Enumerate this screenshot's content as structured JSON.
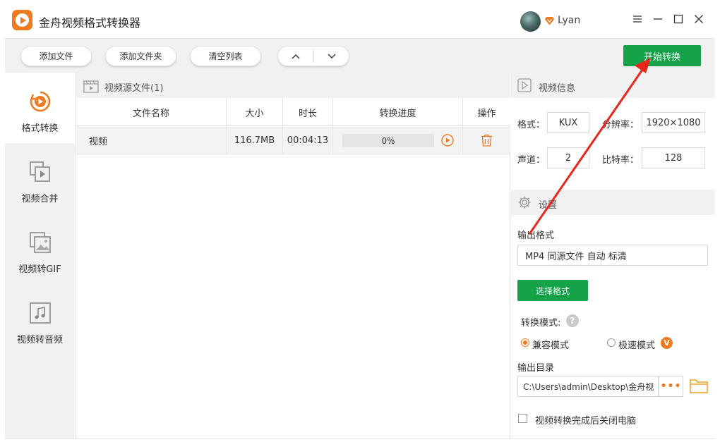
{
  "app": {
    "title": "金舟视频格式转换器",
    "username": "Lyan"
  },
  "toolbar": {
    "add_file": "添加文件",
    "add_folder": "添加文件夹",
    "clear_list": "清空列表",
    "start_convert": "开始转换"
  },
  "nav": {
    "items": [
      {
        "label": "格式转换",
        "icon": "format-convert-icon",
        "active": true
      },
      {
        "label": "视频合并",
        "icon": "video-merge-icon",
        "active": false
      },
      {
        "label": "视频转GIF",
        "icon": "gif-image-icon",
        "active": false
      },
      {
        "label": "视频转音频",
        "icon": "music-note-icon",
        "active": false
      }
    ]
  },
  "filelist": {
    "header": "视频源文件(1)",
    "columns": [
      "文件名称",
      "大小",
      "时长",
      "转换进度",
      "操作"
    ],
    "rows": [
      {
        "name": "视频",
        "size": "116.7MB",
        "duration": "00:04:13",
        "progress_text": "0%",
        "progress": 0
      }
    ]
  },
  "video_info": {
    "header": "视频信息",
    "format_label": "格式：",
    "format_value": "KUX",
    "resolution_label": "分辨率：",
    "resolution_value": "1920×1080",
    "channels_label": "声道：",
    "channels_value": "2",
    "bitrate_label": "比特率：",
    "bitrate_value": "128"
  },
  "settings": {
    "header": "设置",
    "output_format_label": "输出格式",
    "output_format_value": "MP4 同源文件 自动 标清",
    "select_format_button": "选择格式",
    "mode_label": "转换模式:",
    "mode_compatible": "兼容模式",
    "mode_fast": "极速模式",
    "vip_badge": "V",
    "output_dir_label": "输出目录",
    "output_dir_value": "C:\\Users\\admin\\Desktop\\金舟视",
    "shutdown_label": "视频转换完成后关闭电脑"
  },
  "colors": {
    "accent": "#f07a1e",
    "green": "#15a34a",
    "annotation": "#e8261c"
  }
}
